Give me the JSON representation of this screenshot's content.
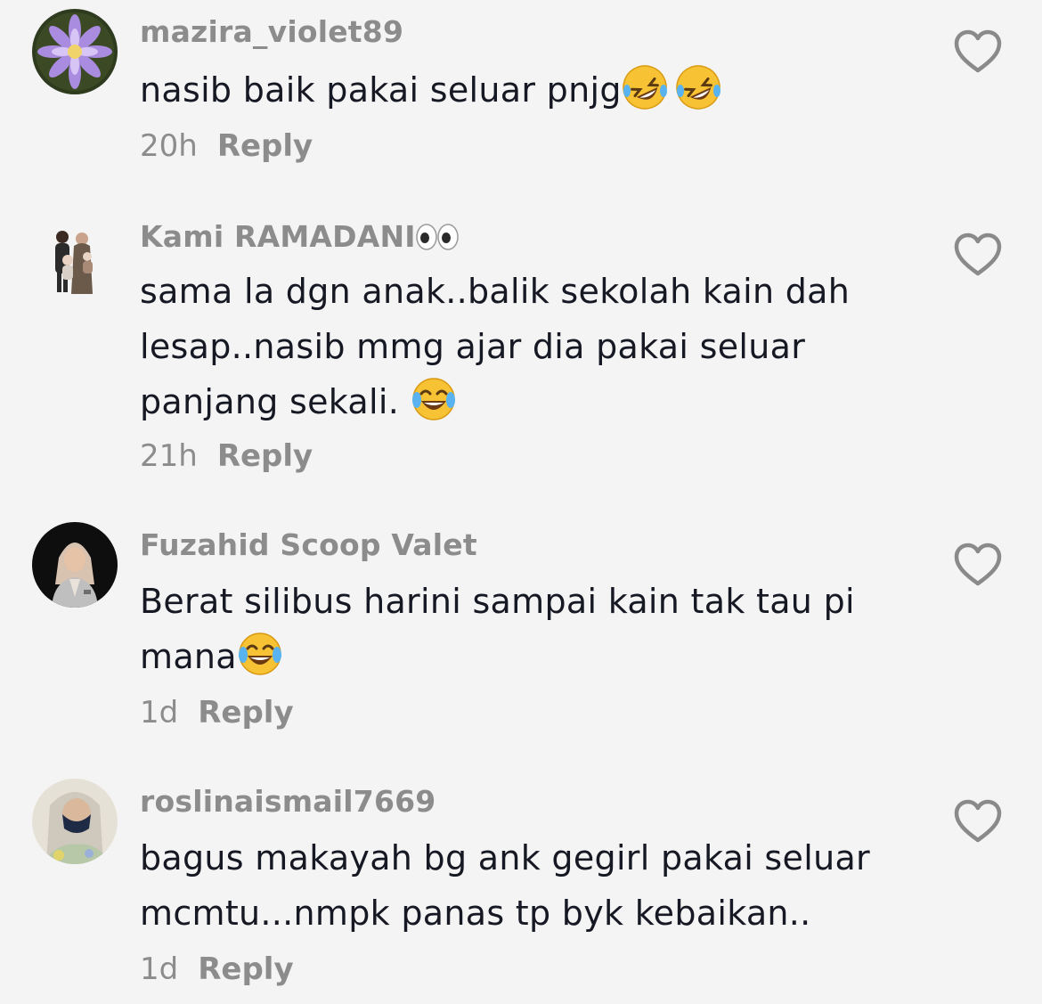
{
  "comments": [
    {
      "username": "mazira_violet89",
      "text_lines": [
        "nasib baik pakai seluar pnjg"
      ],
      "emojis": [
        "rolling-on-floor-laughing-emoji",
        "rolling-on-floor-laughing-emoji"
      ],
      "time": "20h",
      "reply_label": "Reply",
      "avatar": "flower-avatar"
    },
    {
      "username": "Kami RAMADANI",
      "username_emoji": "eyes-emoji",
      "text_lines": [
        "sama la dgn anak..balik sekolah kain dah",
        "lesap..nasib mmg ajar dia pakai seluar",
        "panjang sekali."
      ],
      "emojis": [
        "tears-of-joy-emoji"
      ],
      "time": "21h",
      "reply_label": "Reply",
      "avatar": "family-photo-avatar"
    },
    {
      "username": "Fuzahid Scoop Valet",
      "text_lines": [
        "Berat silibus harini sampai kain tak tau pi",
        "mana"
      ],
      "emojis": [
        "tears-of-joy-emoji"
      ],
      "time": "1d",
      "reply_label": "Reply",
      "avatar": "woman-hijab-avatar"
    },
    {
      "username": "roslinaismail7669",
      "text_lines": [
        "bagus makayah bg ank gegirl pakai seluar",
        "mcmtu...nmpk panas tp byk kebaikan.."
      ],
      "emojis": [],
      "time": "1d",
      "reply_label": "Reply",
      "avatar": "masked-woman-avatar"
    }
  ],
  "colors": {
    "background": "#f4f4f4",
    "text": "#161823",
    "muted": "#8c8c8c",
    "heart_outline": "#8a8a8a"
  },
  "icons": [
    "heart-outline-icon"
  ]
}
